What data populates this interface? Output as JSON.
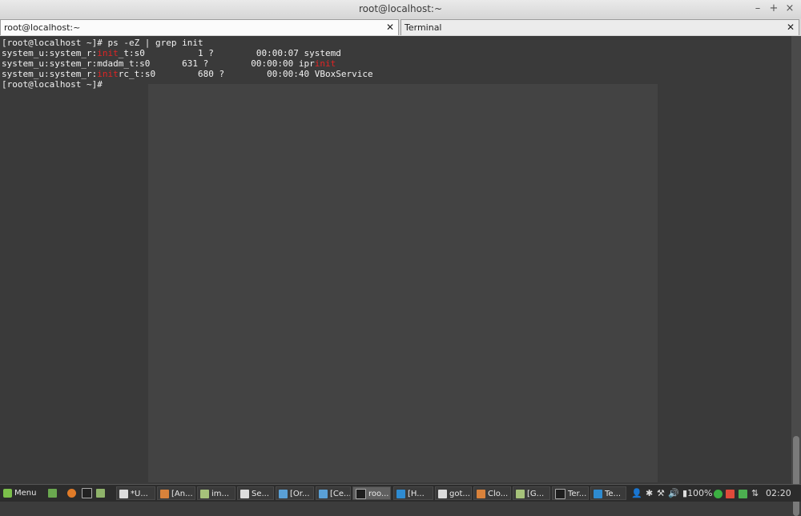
{
  "window": {
    "title": "root@localhost:~"
  },
  "tabs": [
    {
      "label": "root@localhost:~"
    },
    {
      "label": "Terminal"
    }
  ],
  "terminal": {
    "lines": [
      {
        "parts": [
          {
            "t": "[root@localhost ~]# ps -eZ | grep init"
          }
        ]
      },
      {
        "parts": [
          {
            "t": "system_u:system_r:"
          },
          {
            "t": "init",
            "hl": true
          },
          {
            "t": "_t:s0          1 ?        00:00:07 systemd"
          }
        ]
      },
      {
        "parts": [
          {
            "t": "system_u:system_r:mdadm_t:s0      631 ?        00:00:00 ipr"
          },
          {
            "t": "init",
            "hl": true
          }
        ]
      },
      {
        "parts": [
          {
            "t": "system_u:system_r:"
          },
          {
            "t": "init",
            "hl": true
          },
          {
            "t": "rc_t:s0        680 ?        00:00:40 VBoxService"
          }
        ]
      },
      {
        "parts": [
          {
            "t": "[root@localhost ~]#"
          }
        ]
      }
    ],
    "highlight_color": "#e02424"
  },
  "taskbar": {
    "menu_label": "Menu",
    "items": [
      {
        "label": "*U...",
        "icon": "document-icon"
      },
      {
        "label": "[An...",
        "icon": "app-icon"
      },
      {
        "label": "im...",
        "icon": "folder-icon"
      },
      {
        "label": "Se...",
        "icon": "document-icon"
      },
      {
        "label": "[Or...",
        "icon": "image-icon"
      },
      {
        "label": "[Ce...",
        "icon": "image-icon"
      },
      {
        "label": "roo...",
        "icon": "terminal-icon",
        "active": true
      },
      {
        "label": "[H...",
        "icon": "chat-icon"
      },
      {
        "label": "got...",
        "icon": "document-icon"
      },
      {
        "label": "Clo...",
        "icon": "app-icon"
      },
      {
        "label": "[G...",
        "icon": "folder-icon"
      },
      {
        "label": "Ter...",
        "icon": "terminal-icon"
      },
      {
        "label": "Te...",
        "icon": "chat-icon"
      }
    ],
    "battery": "100%",
    "clock": "02:20"
  }
}
